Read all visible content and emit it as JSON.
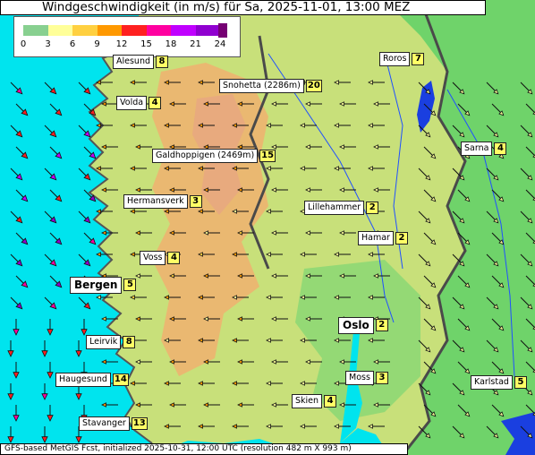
{
  "title": "Windgeschwindigkeit (in m/s) für Sa, 2025-11-01, 13:00 MEZ",
  "footer": "GFS-based MetGIS Fcst, initialized 2025-10-31, 12:00 UTC  (resolution 482 m X 993 m)",
  "legend": {
    "ticks": [
      "0",
      "3",
      "6",
      "9",
      "12",
      "15",
      "18",
      "21",
      "24"
    ],
    "colors": [
      "#88d090",
      "#ffff99",
      "#ffd040",
      "#ff9900",
      "#ff2020",
      "#ff00a0",
      "#c000ff",
      "#9000d0"
    ],
    "overflow_color": "#760073"
  },
  "colors": {
    "sea": "#00e4ee",
    "lowland": "#6fd36a",
    "upland": "#c8e07a",
    "mountain": "#f0b070",
    "high": "#e8a880",
    "lake": "#1a3fe0",
    "border": "#4a4a4a",
    "river": "#2050ff"
  },
  "stations": [
    {
      "name": "Alesund",
      "speed": "8",
      "style": "normal"
    },
    {
      "name": "Roros",
      "speed": "7",
      "style": "normal"
    },
    {
      "name": "Snohetta (2286m)",
      "speed": "20",
      "style": "normal"
    },
    {
      "name": "Volda",
      "speed": "4",
      "style": "normal"
    },
    {
      "name": "Sarna",
      "speed": "4",
      "style": "normal"
    },
    {
      "name": "Galdhoppigen (2469m)",
      "speed": "15",
      "style": "normal"
    },
    {
      "name": "Hermansverk",
      "speed": "3",
      "style": "normal"
    },
    {
      "name": "Lillehammer",
      "speed": "2",
      "style": "normal"
    },
    {
      "name": "Hamar",
      "speed": "2",
      "style": "normal"
    },
    {
      "name": "Voss",
      "speed": "4",
      "style": "normal"
    },
    {
      "name": "Bergen",
      "speed": "5",
      "style": "big"
    },
    {
      "name": "Oslo",
      "speed": "2",
      "style": "big"
    },
    {
      "name": "Leirvik",
      "speed": "8",
      "style": "normal"
    },
    {
      "name": "Haugesund",
      "speed": "14",
      "style": "normal"
    },
    {
      "name": "Moss",
      "speed": "3",
      "style": "normal"
    },
    {
      "name": "Karlstad",
      "speed": "5",
      "style": "normal"
    },
    {
      "name": "Skien",
      "speed": "4",
      "style": "normal"
    },
    {
      "name": "Stavanger",
      "speed": "13",
      "style": "normal"
    }
  ],
  "wind_arrows": [
    {
      "speed": 17,
      "dir": "SE"
    },
    {
      "speed": 10,
      "dir": "ESE"
    },
    {
      "speed": 5,
      "dir": "ESE"
    },
    {
      "speed": 14,
      "dir": "SE"
    },
    {
      "speed": 19,
      "dir": "SE"
    },
    {
      "speed": 20,
      "dir": "SE"
    },
    {
      "speed": 12,
      "dir": "SE"
    },
    {
      "speed": 22,
      "dir": "SE"
    },
    {
      "speed": 22,
      "dir": "SE"
    },
    {
      "speed": 16,
      "dir": "S"
    },
    {
      "speed": 21,
      "dir": "S"
    },
    {
      "speed": 17,
      "dir": "N"
    },
    {
      "speed": 10,
      "dir": "N"
    },
    {
      "speed": 3,
      "dir": "W"
    },
    {
      "speed": 8,
      "dir": "NE"
    }
  ]
}
